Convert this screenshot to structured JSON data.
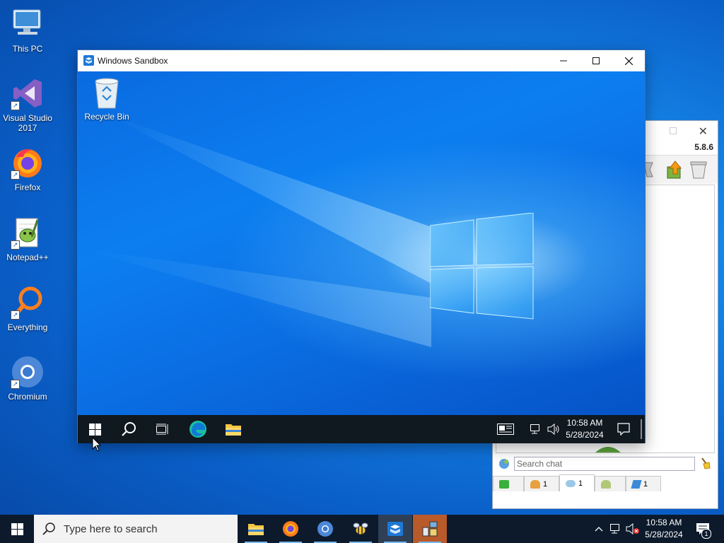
{
  "desktop": {
    "icons": [
      {
        "label": "This PC"
      },
      {
        "label": "Visual Studio 2017"
      },
      {
        "label": "Firefox"
      },
      {
        "label": "Notepad++"
      },
      {
        "label": "Everything"
      },
      {
        "label": "Chromium"
      }
    ]
  },
  "sandbox": {
    "title": "Windows Sandbox",
    "desktop_icon": "Recycle Bin",
    "taskbar": {
      "time": "10:58 AM",
      "date": "5/28/2024"
    }
  },
  "back_window": {
    "version": "5.8.6",
    "search_placeholder": "Search chat",
    "tabs": [
      {
        "count": ""
      },
      {
        "count": "1"
      },
      {
        "count": "1"
      },
      {
        "count": ""
      },
      {
        "count": "1"
      }
    ]
  },
  "taskbar": {
    "search_placeholder": "Type here to search",
    "time": "10:58 AM",
    "date": "5/28/2024",
    "notification_count": "1"
  },
  "colors": {
    "taskbar_bg": "#0c1a2c",
    "accent": "#1e78d6",
    "active_app": "#b95a2a"
  }
}
